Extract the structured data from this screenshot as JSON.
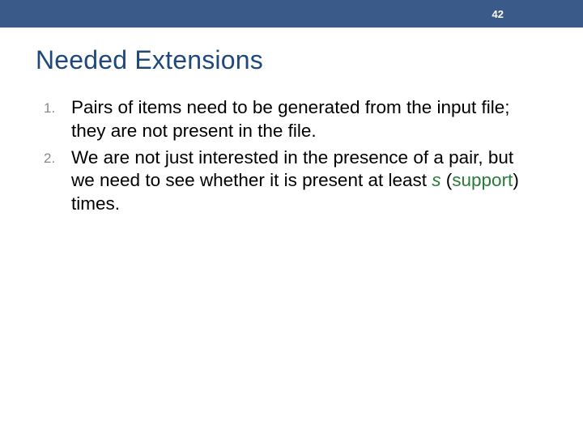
{
  "header": {
    "page_number": "42"
  },
  "title": "Needed Extensions",
  "items": [
    {
      "marker": "1.",
      "text": "Pairs of items need to be generated from the input file; they are not present in the file."
    },
    {
      "marker": "2.",
      "prefix": "We are not just interested in the presence of a pair, but we need to see whether it is present at least ",
      "var": "s",
      "mid": "  (",
      "support": "support",
      "suffix": ") times."
    }
  ]
}
